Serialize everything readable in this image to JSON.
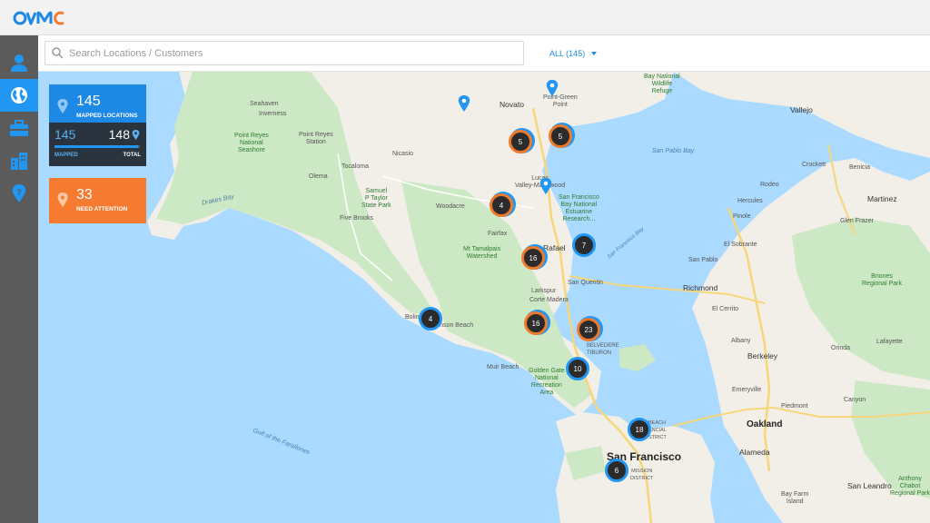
{
  "app": {
    "logo_text": "OVIC"
  },
  "search": {
    "placeholder": "Search Locations / Customers",
    "value": ""
  },
  "filter": {
    "label": "ALL (145)"
  },
  "sidebar": {
    "items": [
      {
        "name": "user",
        "icon": "user-icon",
        "active": false
      },
      {
        "name": "globe",
        "icon": "globe-icon",
        "active": true
      },
      {
        "name": "toolbox",
        "icon": "toolbox-icon",
        "active": false
      },
      {
        "name": "buildings",
        "icon": "buildings-icon",
        "active": false
      },
      {
        "name": "location",
        "icon": "location-pin-icon",
        "active": false
      }
    ]
  },
  "stats": {
    "mapped": {
      "count": "145",
      "label": "MAPPED LOCATIONS",
      "mapped_value": "145",
      "total_value": "148",
      "mapped_label": "MAPPED",
      "total_label": "TOTAL",
      "progress": 0.98
    },
    "attention": {
      "count": "33",
      "label": "NEED ATTENTION"
    }
  },
  "map_labels": {
    "seahaven": "Seahaven",
    "inverness": "Inverness",
    "point_reyes_ns": "Point Reyes\nNational\nSeashore",
    "point_reyes_station": "Point Reyes\nStation",
    "olema": "Olema",
    "tocaloma": "Tocaloma",
    "nicasio": "Nicasio",
    "samuel_taylor": "Samuel\nP Taylor\nState Park",
    "five_brooks": "Five Brooks",
    "woodacre": "Woodacre",
    "novato": "Novato",
    "lucas_valley": "Lucas\nValley-Marinwood",
    "fairfax": "Fairfax",
    "san_rafael": "Rafael",
    "mt_tamalpais": "Mt Tamalpais\nWatershed",
    "larkspur": "Larkspur",
    "corte_madera": "Corte Madera",
    "san_quentin": "San Quentin",
    "bolinas": "Bolin",
    "stinson": "Stinson Beach",
    "muir_beach": "Muir Beach",
    "golden_gate": "Golden Gate\nNational\nRecreation\nArea",
    "belvedere": "BELVEDERE\nTIBURON",
    "sf_bay_refuge": "San Francisco\nBay National\nEstuarine\nResearch...",
    "bay_refuge": "Bay National\nWildlife\nRefuge",
    "point_green": "Point-Green\nPoint",
    "vallejo": "Vallejo",
    "crockett": "Crockett",
    "benicia": "Benicia",
    "rodeo": "Rodeo",
    "hercules": "Hercules",
    "martinez": "Martinez",
    "pinole": "Pinole",
    "glen_frazer": "Glen Frazer",
    "el_sobrante": "El Sobrante",
    "san_pablo": "San Pablo",
    "richmond": "Richmond",
    "briones": "Briones\nRegional Park",
    "el_cerrito": "El Cerrito",
    "albany": "Albany",
    "berkeley": "Berkeley",
    "orinda": "Orinda",
    "lafayette": "Lafayette",
    "emeryville": "Emeryville",
    "piedmont": "Piedmont",
    "canyon": "Canyon",
    "oakland": "Oakland",
    "alameda": "Alameda",
    "san_francisco": "San Francisco",
    "mission_district": "MISSION\nDISTRICT",
    "financial": "BEACH\nANCIAL\nSTRICT",
    "bay_farm": "Bay Farm\nIsland",
    "san_leandro": "San Leandro",
    "anthony_chabot": "Anthony\nChabot\nRegional Park",
    "san_pablo_bay": "San Pablo Bay",
    "drakes_bay": "Drakes Bay",
    "gulf_farallones": "Gulf of the Farallones",
    "sf_bay": "San Francisco Bay"
  },
  "clusters": [
    {
      "count": "5",
      "variant": "orange"
    },
    {
      "count": "5",
      "variant": "orange"
    },
    {
      "count": "4",
      "variant": "orange"
    },
    {
      "count": "7",
      "variant": "blue"
    },
    {
      "count": "16",
      "variant": "orange"
    },
    {
      "count": "16",
      "variant": "orange"
    },
    {
      "count": "23",
      "variant": "orange"
    },
    {
      "count": "4",
      "variant": "blue"
    },
    {
      "count": "10",
      "variant": "blue"
    },
    {
      "count": "18",
      "variant": "blue"
    },
    {
      "count": "6",
      "variant": "blue"
    }
  ],
  "colors": {
    "accent": "#2196f3",
    "attention": "#f47b30",
    "water": "#aadaff",
    "land": "#f1efe8",
    "park": "#cde8c4"
  }
}
